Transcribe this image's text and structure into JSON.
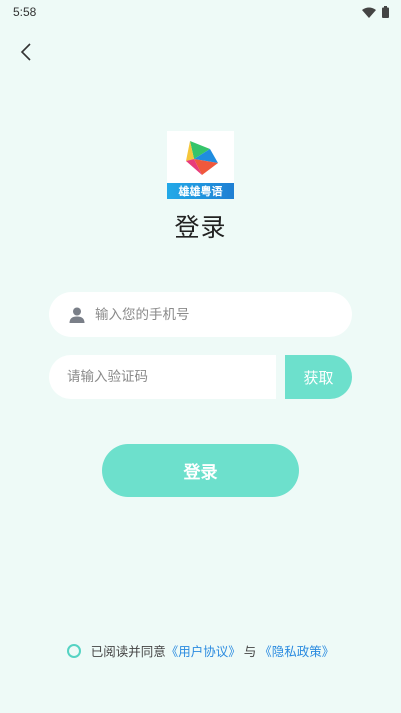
{
  "status_bar": {
    "time": "5:58",
    "icons": [
      "wifi-icon",
      "battery-icon"
    ]
  },
  "header": {
    "back_icon": "chevron-left-icon"
  },
  "logo": {
    "banner_text": "雄雄粤语"
  },
  "title": "登录",
  "form": {
    "phone_placeholder": "输入您的手机号",
    "phone_icon": "user-icon",
    "code_placeholder": "请输入验证码",
    "get_code_label": "获取",
    "login_label": "登录"
  },
  "agreement": {
    "prefix": "已阅读并同意",
    "user_agreement": "《用户协议》",
    "joiner": "与",
    "privacy_policy": "《隐私政策》"
  },
  "colors": {
    "background": "#eefaf7",
    "accent": "#6de0cc",
    "link": "#2b8be0"
  }
}
